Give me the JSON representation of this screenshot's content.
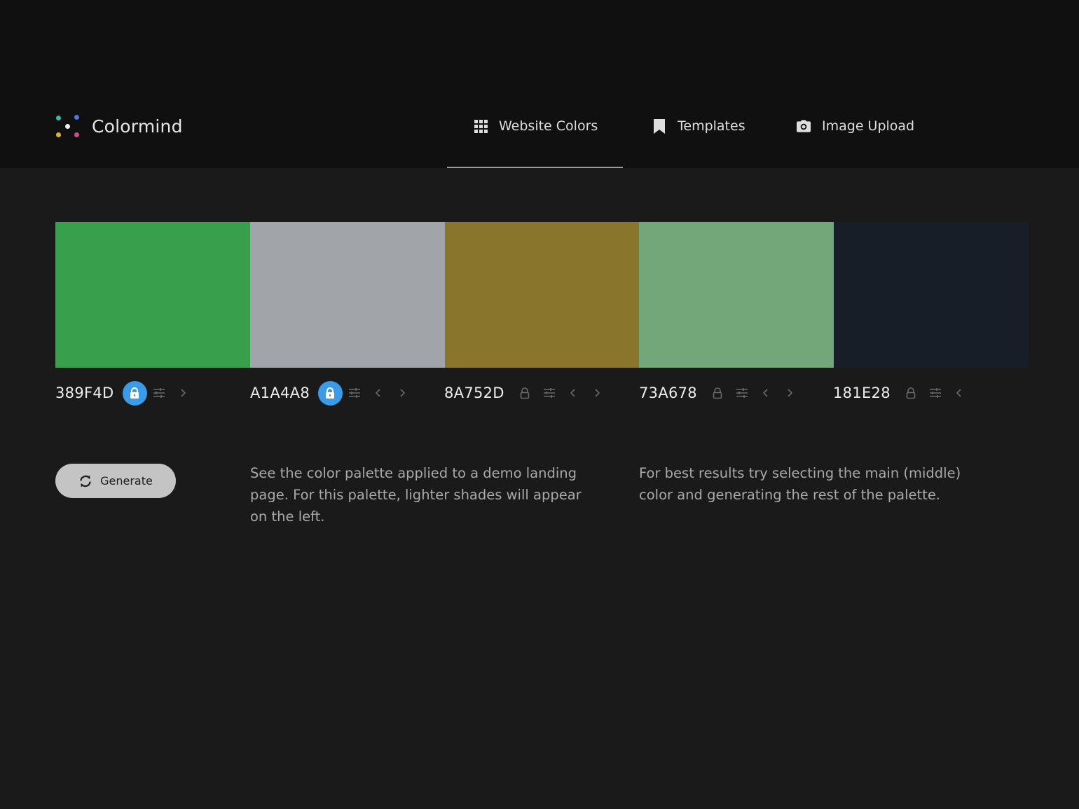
{
  "app": {
    "name": "Colormind"
  },
  "nav": {
    "items": [
      {
        "label": "Website Colors",
        "icon": "grid-icon",
        "active": true
      },
      {
        "label": "Templates",
        "icon": "bookmark-icon",
        "active": false
      },
      {
        "label": "Image Upload",
        "icon": "camera-icon",
        "active": false
      }
    ]
  },
  "palette": {
    "colors": [
      {
        "hex": "389F4D",
        "color": "#389F4D",
        "locked": true
      },
      {
        "hex": "A1A4A8",
        "color": "#A1A4A8",
        "locked": true
      },
      {
        "hex": "8A752D",
        "color": "#8A752D",
        "locked": false
      },
      {
        "hex": "73A678",
        "color": "#73A678",
        "locked": false
      },
      {
        "hex": "181E28",
        "color": "#181E28",
        "locked": false
      }
    ]
  },
  "actions": {
    "generate_label": "Generate"
  },
  "descriptions": {
    "demo": "See the color palette applied to a demo landing page. For this palette, lighter shades will appear on the left.",
    "tip": "For best results try selecting the main (middle) color and generating the rest of the palette."
  },
  "theme": {
    "background": "#1a1a1a",
    "header_background": "#101010",
    "lock_active": "#3b9be6"
  }
}
